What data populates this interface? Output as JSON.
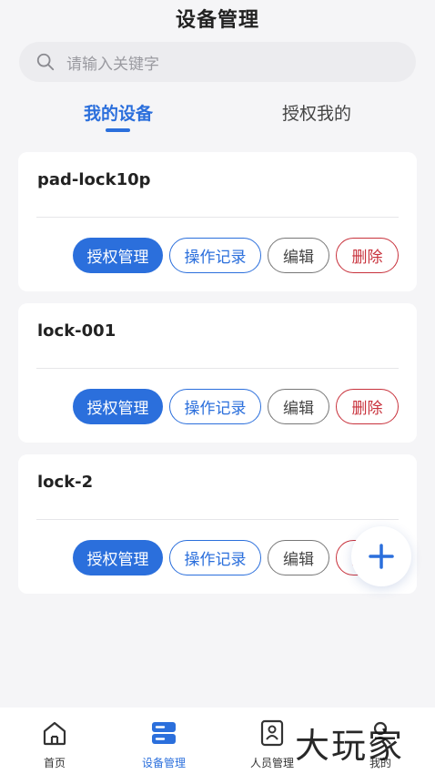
{
  "header": {
    "title": "设备管理"
  },
  "search": {
    "placeholder": "请输入关键字"
  },
  "tabs": [
    {
      "label": "我的设备",
      "active": true
    },
    {
      "label": "授权我的",
      "active": false
    }
  ],
  "devices": [
    {
      "name": "pad-lock10p"
    },
    {
      "name": "lock-001"
    },
    {
      "name": "lock-2"
    }
  ],
  "actions": {
    "auth": "授权管理",
    "log": "操作记录",
    "edit": "编辑",
    "delete": "删除"
  },
  "bottom_nav": [
    {
      "label": "首页",
      "icon": "home-icon",
      "active": false
    },
    {
      "label": "设备管理",
      "icon": "device-icon",
      "active": true
    },
    {
      "label": "人员管理",
      "icon": "person-icon",
      "active": false
    },
    {
      "label": "我的",
      "icon": "profile-icon",
      "active": false
    }
  ],
  "watermark": "大玩家",
  "colors": {
    "accent": "#2b6fdc",
    "danger": "#c8323c",
    "background": "#f5f5f7"
  }
}
